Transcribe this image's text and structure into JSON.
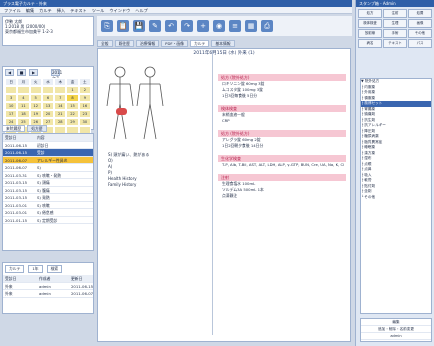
{
  "window": {
    "title": "プラス電子カルテ  - 外来"
  },
  "menu": [
    "ファイル",
    "編集",
    "カルテ",
    "挿入",
    "テキスト",
    "ツール",
    "ウインドウ",
    "ヘルプ"
  ],
  "patient": {
    "line1": "伊勢 太郎",
    "line2": "1:2018 男 (2000/00)",
    "line3": "東京都福生市加美平 1-2-3"
  },
  "tabs": [
    "全般",
    "既往歴",
    "治療情報",
    "PDF・画像",
    "カルテ",
    "基本情報"
  ],
  "calendar": {
    "month": "2011年7月",
    "weekdays": [
      "日",
      "月",
      "火",
      "水",
      "木",
      "金",
      "土"
    ],
    "days": [
      "",
      "",
      "",
      "",
      "",
      "1",
      "2",
      "3",
      "4",
      "5",
      "6",
      "7",
      "8",
      "9",
      "10",
      "11",
      "12",
      "13",
      "14",
      "15",
      "16",
      "17",
      "18",
      "19",
      "20",
      "21",
      "22",
      "23",
      "24",
      "25",
      "26",
      "27",
      "28",
      "29",
      "30",
      "31",
      "",
      "",
      "",
      "",
      "",
      ""
    ],
    "today": "8"
  },
  "list_tabs": [
    "来院履歴",
    "処方歴"
  ],
  "visits": {
    "headers": [
      "受診日",
      "内容"
    ],
    "rows": [
      {
        "date": "2011-06-15",
        "text": "初診日"
      },
      {
        "date": "2011-06-15",
        "text": "受診"
      },
      {
        "date": "2011-06-07",
        "text": "アレルギー性鼻炎"
      },
      {
        "date": "2011-06-07",
        "text": "S)"
      },
      {
        "date": "2011-03-31",
        "text": "S) 咳嗽・発熱"
      },
      {
        "date": "2011-03-15",
        "text": "S) 頭痛"
      },
      {
        "date": "2011-03-15",
        "text": "S) 腹痛"
      },
      {
        "date": "2011-03-15",
        "text": "S) 発熱"
      },
      {
        "date": "2011-03-01",
        "text": "S) 咳嗽"
      },
      {
        "date": "2011-03-01",
        "text": "S) 倦怠感"
      },
      {
        "date": "2011-01-15",
        "text": "S) 定期受診"
      }
    ]
  },
  "bottom_left": {
    "select1": "カルテ",
    "select2": "1年",
    "btn": "検索",
    "headers": [
      "受診日",
      "作成者",
      "更新日"
    ],
    "rows": [
      {
        "a": "外来",
        "b": "admin",
        "c": "2011-06-15"
      },
      {
        "a": "外来",
        "b": "admin",
        "c": "2011-06-07"
      }
    ]
  },
  "chart": {
    "date_header": "2011年6月15日 (水) 外来 (1)",
    "soap": [
      "S) 頭が痛い、熱がある",
      "O)",
      "A)",
      "P)",
      "Health History",
      "Family History"
    ],
    "orders": [
      {
        "head": "処方 (院外処方)",
        "items": [
          "ロキソニン錠 60mg  3錠",
          "ムコスタ錠 100mg  3錠",
          "1日3回毎食後 5日分"
        ]
      },
      {
        "head": "検体検査",
        "items": [
          "末梢血液一般",
          "CRP"
        ]
      },
      {
        "head": "処方 (院外処方)",
        "items": [
          "アレグラ錠 60mg  2錠",
          "1日2回朝夕食後 14日分"
        ]
      },
      {
        "head": "生化学検査",
        "items": [
          "T-P, Alb, T-Bil, AST, ALT, LDH, ALP, γ-GTP, BUN, Cre, UA, Na, K, Cl"
        ]
      },
      {
        "head": "注射",
        "items": [
          "生理食塩水 100mL",
          "ソルデム3A 500mL  1本",
          "点滴静注"
        ]
      }
    ]
  },
  "right_panel": {
    "title": "スタンプ箱  -  Admin",
    "buttons": [
      "処方",
      "注射",
      "処置",
      "検体検査",
      "生理",
      "画像",
      "放射線",
      "手術",
      "その他",
      "病名",
      "テキスト",
      "パス"
    ],
    "tree": [
      "▼ 院外処方",
      "  ├ 内服薬",
      "  ├ 外用薬",
      "  ├ 頓服薬",
      "  ├ 風邪セット",
      "  ├ 胃腸薬",
      "  ├ 鎮痛剤",
      "  ├ 抗生剤",
      "  ├ 抗アレルギー",
      "  ├ 降圧剤",
      "  ├ 糖尿病薬",
      "  ├ 脂質異常症",
      "  ├ 睡眠薬",
      "  ├ 漢方薬",
      "  ├ 湿布",
      "  ├ 点眼",
      "  ├ 点鼻",
      "  ├ 吸入",
      "  ├ 軟膏",
      "  ├ 貼付剤",
      "  ├ 坐剤",
      "  └ その他"
    ],
    "tree_selected": 4,
    "bottom": [
      "編集",
      "追加・削除・名前変更",
      "admin"
    ]
  }
}
